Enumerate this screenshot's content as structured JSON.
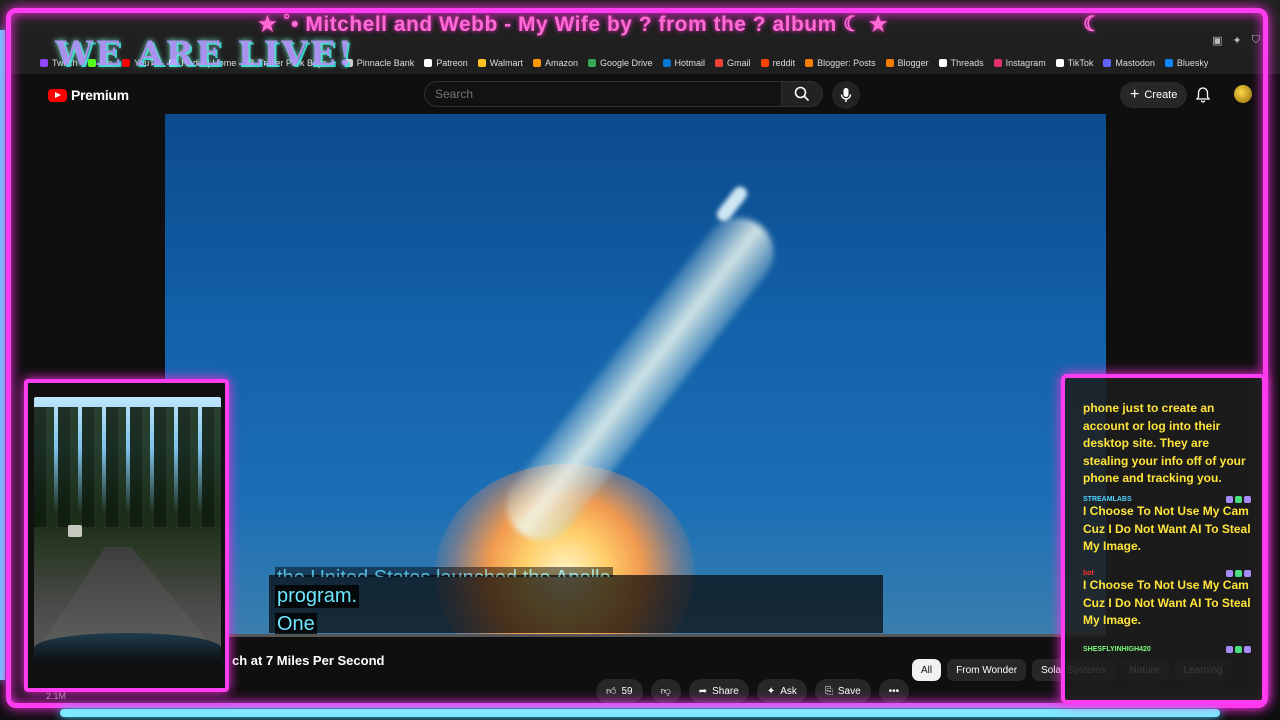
{
  "overlay": {
    "stream_title": "★ ˚• Mitchell and Webb - My Wife by ? from the ? album ☾ ★",
    "moon_right": "☾",
    "live_banner": "WE ARE LIVE!"
  },
  "bookmarks": [
    {
      "label": "Twitch",
      "color": "#9146ff"
    },
    {
      "label": "Kic",
      "color": "#53fc18"
    },
    {
      "label": "YouTu",
      "color": "#ff0000"
    },
    {
      "label": "Radio | Home",
      "color": "#ffffff"
    },
    {
      "label": "Trailer Park Boys +",
      "color": "#888888"
    },
    {
      "label": "Pinnacle Bank",
      "color": "#cccccc"
    },
    {
      "label": "Patreon",
      "color": "#ffffff"
    },
    {
      "label": "Walmart",
      "color": "#ffc220"
    },
    {
      "label": "Amazon",
      "color": "#ff9900"
    },
    {
      "label": "Google Drive",
      "color": "#34a853"
    },
    {
      "label": "Hotmail",
      "color": "#0078d4"
    },
    {
      "label": "Gmail",
      "color": "#ea4335"
    },
    {
      "label": "reddit",
      "color": "#ff4500"
    },
    {
      "label": "Blogger: Posts",
      "color": "#f57d00"
    },
    {
      "label": "Blogger",
      "color": "#f57d00"
    },
    {
      "label": "Threads",
      "color": "#ffffff"
    },
    {
      "label": "Instagram",
      "color": "#e1306c"
    },
    {
      "label": "TikTok",
      "color": "#ffffff"
    },
    {
      "label": "Mastodon",
      "color": "#6364ff"
    },
    {
      "label": "Bluesky",
      "color": "#1185fe"
    }
  ],
  "youtube": {
    "brand": "Premium",
    "search_placeholder": "Search",
    "create_label": "Create",
    "video_title": "ch at 7 Miles Per Second",
    "views": "2.1M",
    "progress": 0.0,
    "captions": {
      "partial": "the United States launched the Apollo",
      "line1": "program.",
      "line2": "One"
    },
    "actions": [
      {
        "icon": "like-icon",
        "label": "59"
      },
      {
        "icon": "dislike-icon",
        "label": ""
      },
      {
        "icon": "share-icon",
        "label": "Share"
      },
      {
        "icon": "ask-icon",
        "label": "Ask"
      },
      {
        "icon": "save-icon",
        "label": "Save"
      },
      {
        "icon": "more-icon",
        "label": "•••"
      }
    ],
    "chips": [
      "All",
      "From Wonder",
      "Solar Systems",
      "Nature",
      "Learning"
    ]
  },
  "chat": {
    "messages": [
      {
        "user": "",
        "user_color": "#ffffff",
        "text": "phone just to create an account or log into their desktop site. They are stealing your info off of your phone and tracking you."
      },
      {
        "user": "STREAMLABS",
        "user_color": "#4fd1ff",
        "text": "I Choose To Not Use My Cam Cuz I Do Not Want AI To Steal My Image."
      },
      {
        "user": "bot",
        "user_color": "#ff3030",
        "text": "I Choose To Not Use My Cam Cuz I Do Not Want AI To Steal My Image."
      },
      {
        "user": "SHESFLYINHIGH420",
        "user_color": "#7dff7d",
        "text": ""
      }
    ]
  },
  "colors": {
    "neon_pink": "#ff3df0",
    "neon_cyan": "#7fe9ff",
    "chat_text": "#ffe53b"
  }
}
